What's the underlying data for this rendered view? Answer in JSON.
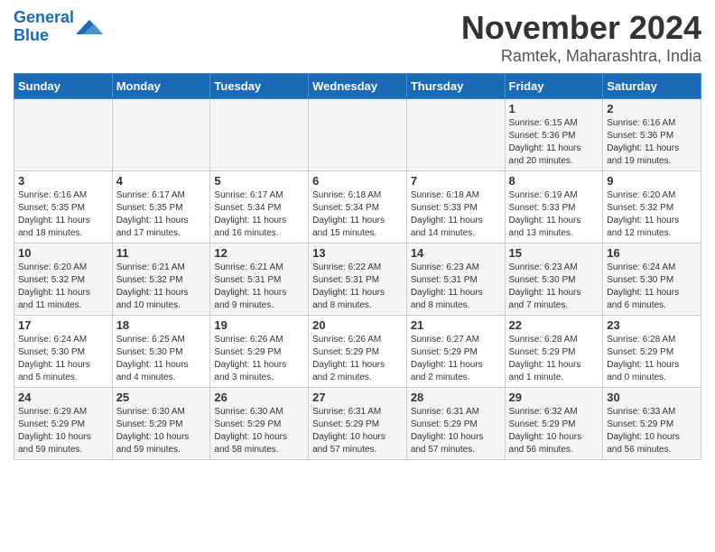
{
  "header": {
    "logo_line1": "General",
    "logo_line2": "Blue",
    "month_title": "November 2024",
    "location": "Ramtek, Maharashtra, India"
  },
  "days_of_week": [
    "Sunday",
    "Monday",
    "Tuesday",
    "Wednesday",
    "Thursday",
    "Friday",
    "Saturday"
  ],
  "weeks": [
    [
      {
        "day": "",
        "info": ""
      },
      {
        "day": "",
        "info": ""
      },
      {
        "day": "",
        "info": ""
      },
      {
        "day": "",
        "info": ""
      },
      {
        "day": "",
        "info": ""
      },
      {
        "day": "1",
        "info": "Sunrise: 6:15 AM\nSunset: 5:36 PM\nDaylight: 11 hours\nand 20 minutes."
      },
      {
        "day": "2",
        "info": "Sunrise: 6:16 AM\nSunset: 5:36 PM\nDaylight: 11 hours\nand 19 minutes."
      }
    ],
    [
      {
        "day": "3",
        "info": "Sunrise: 6:16 AM\nSunset: 5:35 PM\nDaylight: 11 hours\nand 18 minutes."
      },
      {
        "day": "4",
        "info": "Sunrise: 6:17 AM\nSunset: 5:35 PM\nDaylight: 11 hours\nand 17 minutes."
      },
      {
        "day": "5",
        "info": "Sunrise: 6:17 AM\nSunset: 5:34 PM\nDaylight: 11 hours\nand 16 minutes."
      },
      {
        "day": "6",
        "info": "Sunrise: 6:18 AM\nSunset: 5:34 PM\nDaylight: 11 hours\nand 15 minutes."
      },
      {
        "day": "7",
        "info": "Sunrise: 6:18 AM\nSunset: 5:33 PM\nDaylight: 11 hours\nand 14 minutes."
      },
      {
        "day": "8",
        "info": "Sunrise: 6:19 AM\nSunset: 5:33 PM\nDaylight: 11 hours\nand 13 minutes."
      },
      {
        "day": "9",
        "info": "Sunrise: 6:20 AM\nSunset: 5:32 PM\nDaylight: 11 hours\nand 12 minutes."
      }
    ],
    [
      {
        "day": "10",
        "info": "Sunrise: 6:20 AM\nSunset: 5:32 PM\nDaylight: 11 hours\nand 11 minutes."
      },
      {
        "day": "11",
        "info": "Sunrise: 6:21 AM\nSunset: 5:32 PM\nDaylight: 11 hours\nand 10 minutes."
      },
      {
        "day": "12",
        "info": "Sunrise: 6:21 AM\nSunset: 5:31 PM\nDaylight: 11 hours\nand 9 minutes."
      },
      {
        "day": "13",
        "info": "Sunrise: 6:22 AM\nSunset: 5:31 PM\nDaylight: 11 hours\nand 8 minutes."
      },
      {
        "day": "14",
        "info": "Sunrise: 6:23 AM\nSunset: 5:31 PM\nDaylight: 11 hours\nand 8 minutes."
      },
      {
        "day": "15",
        "info": "Sunrise: 6:23 AM\nSunset: 5:30 PM\nDaylight: 11 hours\nand 7 minutes."
      },
      {
        "day": "16",
        "info": "Sunrise: 6:24 AM\nSunset: 5:30 PM\nDaylight: 11 hours\nand 6 minutes."
      }
    ],
    [
      {
        "day": "17",
        "info": "Sunrise: 6:24 AM\nSunset: 5:30 PM\nDaylight: 11 hours\nand 5 minutes."
      },
      {
        "day": "18",
        "info": "Sunrise: 6:25 AM\nSunset: 5:30 PM\nDaylight: 11 hours\nand 4 minutes."
      },
      {
        "day": "19",
        "info": "Sunrise: 6:26 AM\nSunset: 5:29 PM\nDaylight: 11 hours\nand 3 minutes."
      },
      {
        "day": "20",
        "info": "Sunrise: 6:26 AM\nSunset: 5:29 PM\nDaylight: 11 hours\nand 2 minutes."
      },
      {
        "day": "21",
        "info": "Sunrise: 6:27 AM\nSunset: 5:29 PM\nDaylight: 11 hours\nand 2 minutes."
      },
      {
        "day": "22",
        "info": "Sunrise: 6:28 AM\nSunset: 5:29 PM\nDaylight: 11 hours\nand 1 minute."
      },
      {
        "day": "23",
        "info": "Sunrise: 6:28 AM\nSunset: 5:29 PM\nDaylight: 11 hours\nand 0 minutes."
      }
    ],
    [
      {
        "day": "24",
        "info": "Sunrise: 6:29 AM\nSunset: 5:29 PM\nDaylight: 10 hours\nand 59 minutes."
      },
      {
        "day": "25",
        "info": "Sunrise: 6:30 AM\nSunset: 5:29 PM\nDaylight: 10 hours\nand 59 minutes."
      },
      {
        "day": "26",
        "info": "Sunrise: 6:30 AM\nSunset: 5:29 PM\nDaylight: 10 hours\nand 58 minutes."
      },
      {
        "day": "27",
        "info": "Sunrise: 6:31 AM\nSunset: 5:29 PM\nDaylight: 10 hours\nand 57 minutes."
      },
      {
        "day": "28",
        "info": "Sunrise: 6:31 AM\nSunset: 5:29 PM\nDaylight: 10 hours\nand 57 minutes."
      },
      {
        "day": "29",
        "info": "Sunrise: 6:32 AM\nSunset: 5:29 PM\nDaylight: 10 hours\nand 56 minutes."
      },
      {
        "day": "30",
        "info": "Sunrise: 6:33 AM\nSunset: 5:29 PM\nDaylight: 10 hours\nand 56 minutes."
      }
    ]
  ]
}
